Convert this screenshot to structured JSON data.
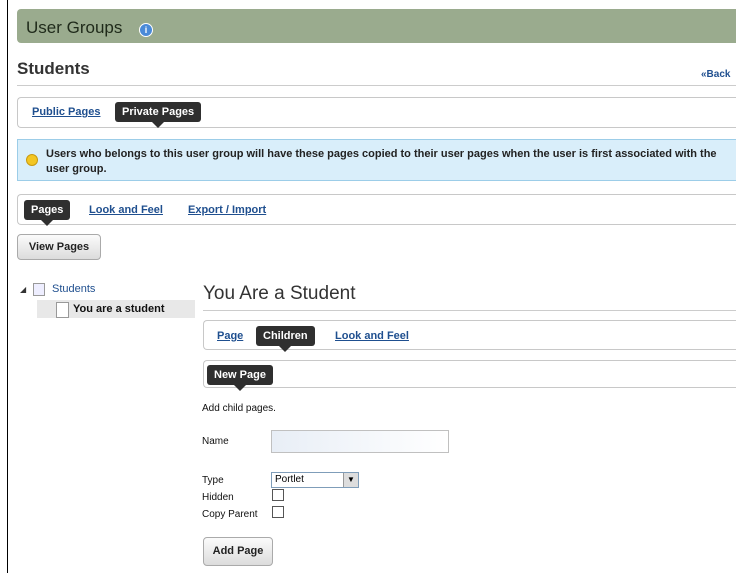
{
  "portlet": {
    "title": "User Groups",
    "info_icon": "info-icon"
  },
  "group": {
    "name": "Students",
    "back_link": "«Back"
  },
  "page_tabs": {
    "public": "Public Pages",
    "private": "Private Pages"
  },
  "info_message": "Users who belongs to this user group will have these pages copied to their user pages when the user is first associated with the user group.",
  "manage_tabs": {
    "pages": "Pages",
    "look_and_feel": "Look and Feel",
    "export_import": "Export / Import"
  },
  "view_pages_button": "View Pages",
  "tree": {
    "root": "Students",
    "child": "You are a student"
  },
  "page": {
    "title": "You Are a Student",
    "tabs": {
      "page": "Page",
      "children": "Children",
      "look_and_feel": "Look and Feel"
    },
    "new_page_tab": "New Page",
    "description": "Add child pages.",
    "form": {
      "name_label": "Name",
      "name_value": "",
      "type_label": "Type",
      "type_value": "Portlet",
      "hidden_label": "Hidden",
      "hidden_checked": false,
      "copy_parent_label": "Copy Parent",
      "copy_parent_checked": false,
      "submit": "Add Page"
    }
  }
}
